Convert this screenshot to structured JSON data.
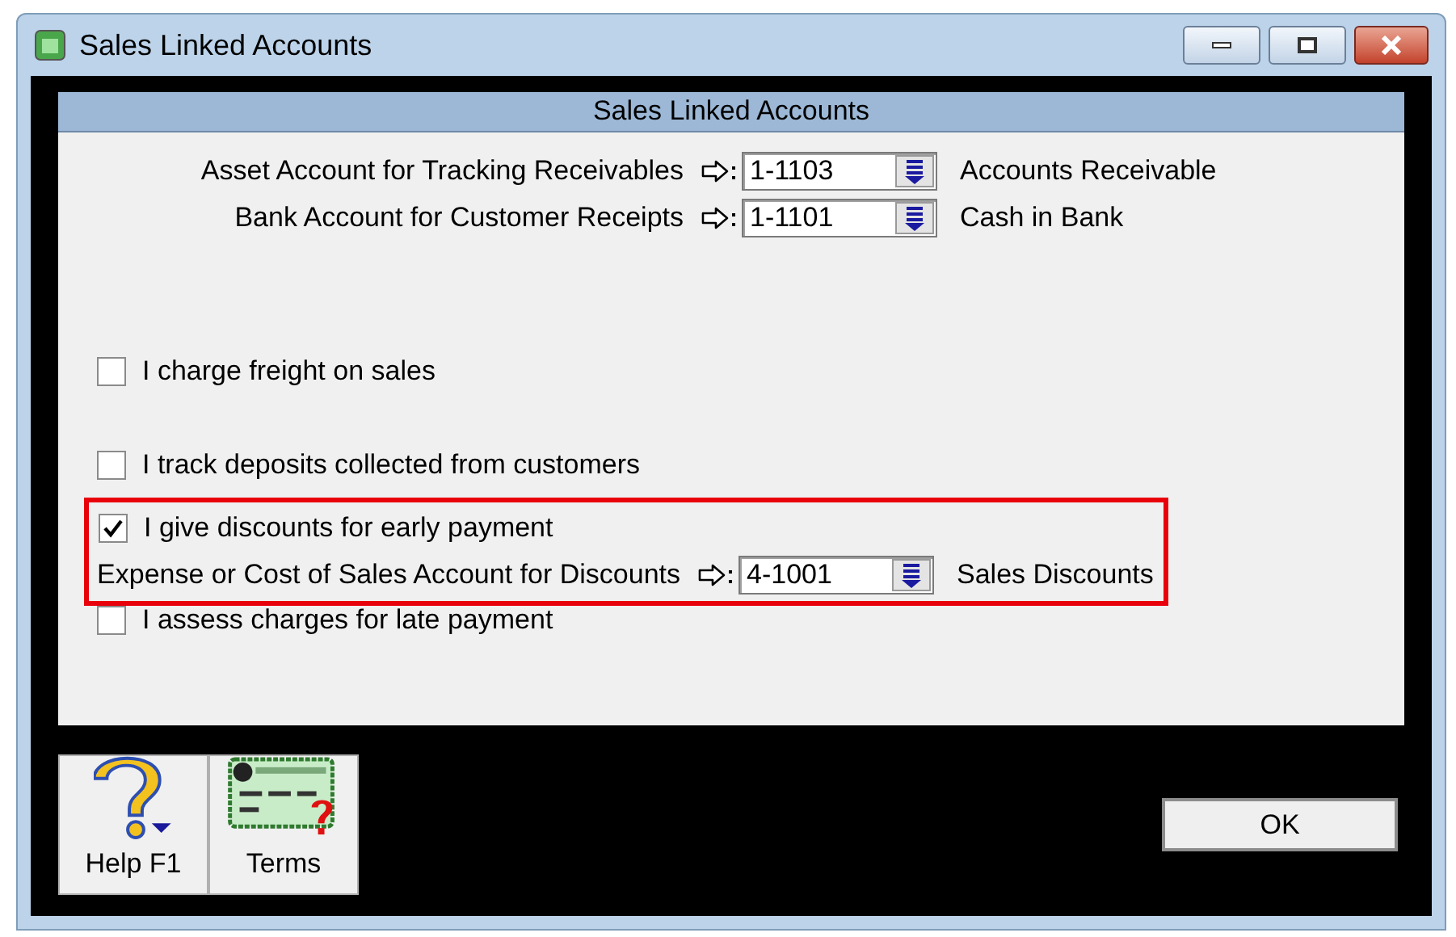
{
  "window": {
    "title": "Sales Linked Accounts"
  },
  "panel": {
    "header": "Sales Linked Accounts"
  },
  "account_links": [
    {
      "label": "Asset Account for Tracking Receivables",
      "code": "1-1103",
      "name": "Accounts Receivable"
    },
    {
      "label": "Bank Account for Customer Receipts",
      "code": "1-1101",
      "name": "Cash in Bank"
    }
  ],
  "options": [
    {
      "label": "I charge freight on sales",
      "checked": false,
      "highlighted": false
    },
    {
      "label": "I track deposits collected from customers",
      "checked": false,
      "highlighted": false
    },
    {
      "label": "I give discounts for early payment",
      "checked": true,
      "highlighted": true,
      "linked_account": {
        "label": "Expense or Cost of Sales Account for Discounts",
        "code": "4-1001",
        "name": "Sales Discounts"
      }
    },
    {
      "label": "I assess charges for late payment",
      "checked": false,
      "highlighted": false
    }
  ],
  "toolbar": [
    {
      "kind": "help",
      "label": "Help F1"
    },
    {
      "kind": "terms",
      "label": "Terms"
    }
  ],
  "ok_button": {
    "label": "OK"
  }
}
